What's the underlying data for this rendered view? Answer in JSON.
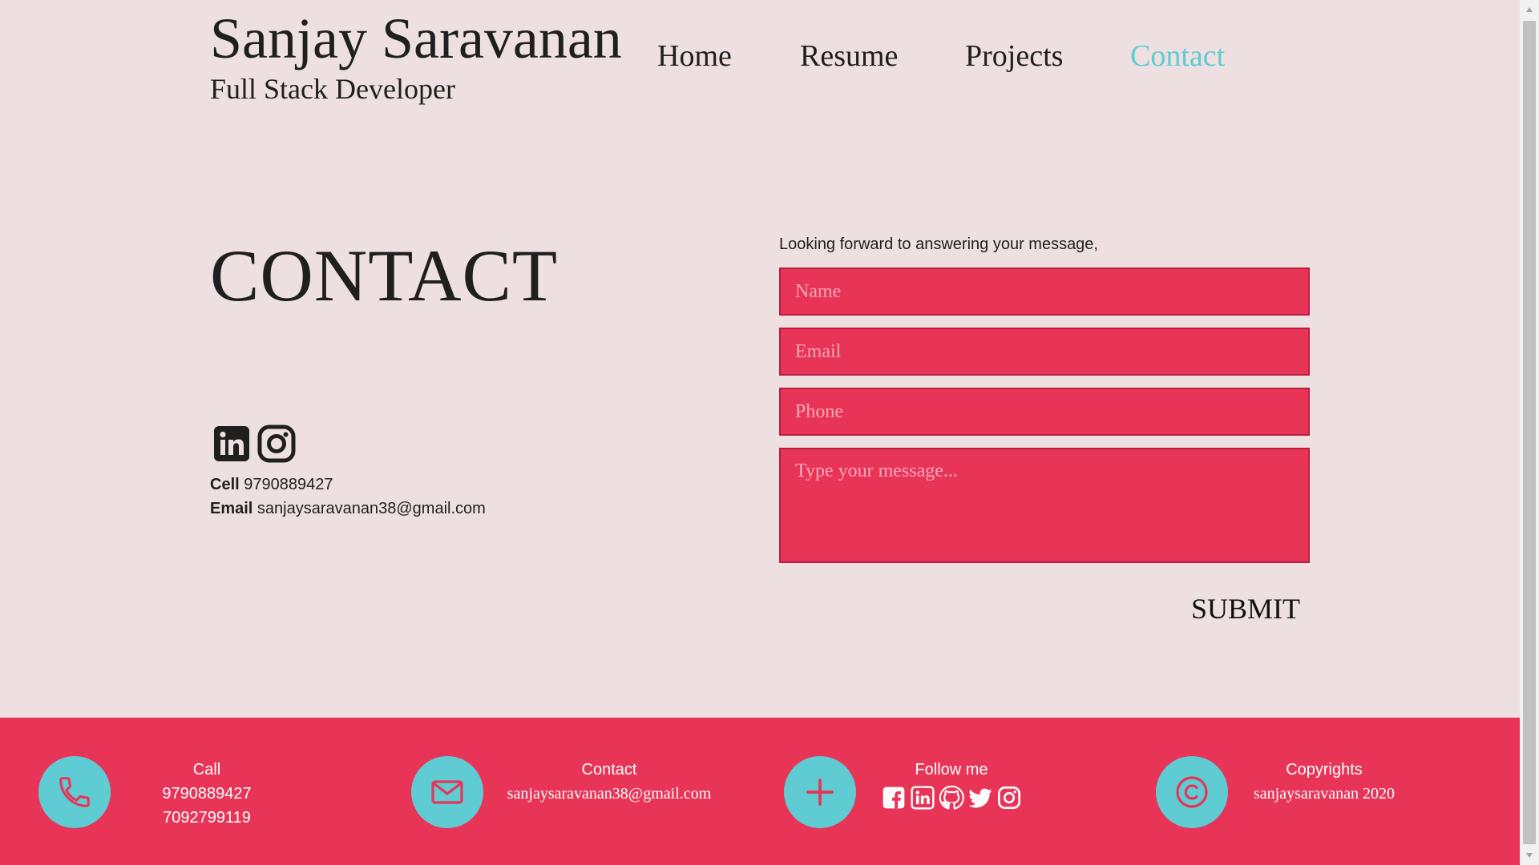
{
  "header": {
    "name": "Sanjay Saravanan",
    "subtitle": "Full Stack Developer",
    "nav": [
      {
        "label": "Home"
      },
      {
        "label": "Resume"
      },
      {
        "label": "Projects"
      },
      {
        "label": "Contact",
        "active": true
      }
    ]
  },
  "contact": {
    "title": "CONTACT",
    "social_icons": [
      "linkedin-icon",
      "instagram-icon"
    ],
    "cell_label": "Cell",
    "cell_value": "9790889427",
    "email_label": "Email",
    "email_value": "sanjaysaravanan38@gmail.com"
  },
  "form": {
    "intro": "Looking forward to answering your message,",
    "name_placeholder": "Name",
    "email_placeholder": "Email",
    "phone_placeholder": "Phone",
    "message_placeholder": "Type your message...",
    "submit_label": "SUBMIT"
  },
  "footer": {
    "call": {
      "heading": "Call",
      "lines": [
        "9790889427",
        "7092799119"
      ],
      "icon": "phone-icon"
    },
    "contact": {
      "heading": "Contact",
      "email": "sanjaysaravanan38@gmail.com",
      "icon": "mail-icon"
    },
    "follow": {
      "heading": "Follow me",
      "icon": "plus-icon",
      "social_icons": [
        "facebook-icon",
        "linkedin-icon",
        "github-icon",
        "twitter-icon",
        "instagram-icon"
      ]
    },
    "copyright": {
      "heading": "Copyrights",
      "text": "sanjaysaravanan 2020",
      "icon": "copyright-icon"
    }
  },
  "colors": {
    "background": "#eee0e0",
    "accent_pink": "#e83457",
    "accent_teal": "#5fcbd3",
    "text": "#1f1f1f"
  }
}
